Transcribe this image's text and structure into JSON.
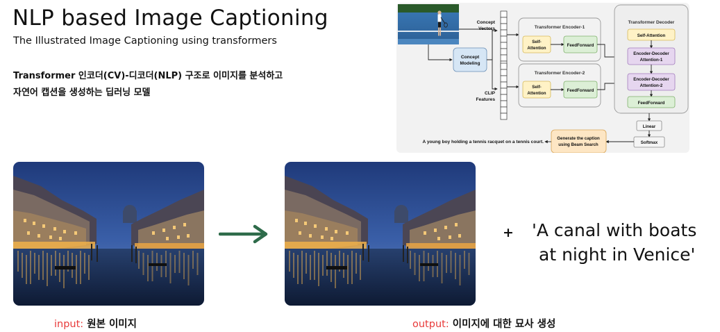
{
  "header": {
    "title": "NLP based Image Captioning",
    "subtitle": "The Illustrated Image Captioning using transformers",
    "description_line1": "Transformer 인코더(CV)-디코더(NLP) 구조로 이미지를 분석하고",
    "description_line2": "자연어 캡션을 생성하는 딥러닝 모델"
  },
  "diagram": {
    "concept_vectors": [
      "Concept",
      "Vectors"
    ],
    "clip_features": [
      "CLIP",
      "Features"
    ],
    "concept_modeling": [
      "Concept",
      "Modeling"
    ],
    "encoder1_title": "Transformer Encoder-1",
    "encoder2_title": "Transformer Encoder-2",
    "self_attention_short": [
      "Self-",
      "Attention"
    ],
    "feedforward": "FeedForward",
    "decoder_title": "Transformer Decoder",
    "decoder_self_attention": "Self-Attention",
    "enc_dec_attention1": [
      "Encoder-Decoder",
      "Attention-1"
    ],
    "enc_dec_attention2": [
      "Encoder-Decoder",
      "Attention-2"
    ],
    "decoder_feedforward": "FeedForward",
    "linear": "Linear",
    "softmax": "Softmax",
    "beam_search": [
      "Generate the caption",
      "using Beam Search"
    ],
    "generated_caption": "A young boy holding a tennis racquet on a tennis court."
  },
  "demo": {
    "plus": "+",
    "caption_line1": "'A canal with boats",
    "caption_line2": "at night in Venice'",
    "input_key": "input:",
    "input_value": " 원본 이미지",
    "output_key": "output:",
    "output_value": " 이미지에 대한 묘사 생성"
  },
  "colors": {
    "arrow": "#2e6b4a",
    "label_key": "#e83a3a",
    "concept_modeling_fill": "#d6e6f5",
    "self_attention_fill": "#fff2c6",
    "feedforward_fill": "#dcefd6",
    "enc_dec_fill": "#e6d6ef",
    "beam_search_fill": "#fde6c4"
  }
}
